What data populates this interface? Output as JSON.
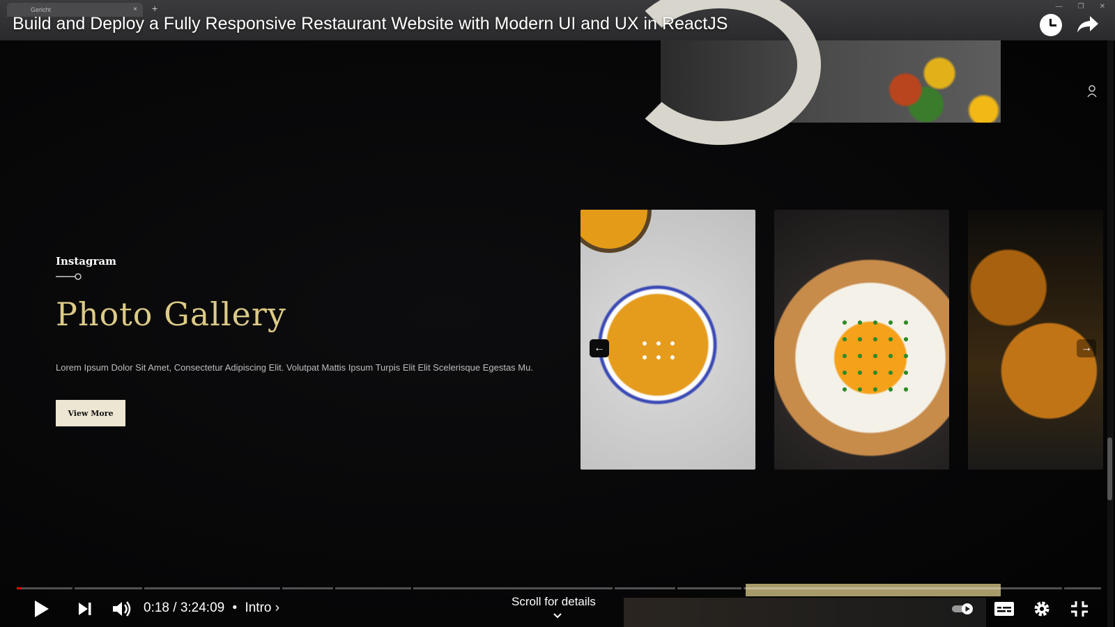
{
  "browser": {
    "tab_title": "Gericht",
    "tab_close": "×",
    "new_tab": "+",
    "window_controls": [
      "—",
      "❐",
      "✕"
    ]
  },
  "video": {
    "title": "Build and Deploy a Fully Responsive Restaurant Website with Modern UI and UX in ReactJS",
    "watch_later_icon": "clock-icon",
    "share_icon": "share-arrow-icon"
  },
  "page": {
    "gallery": {
      "subtitle": "Instagram",
      "title": "Photo Gallery",
      "description": "Lorem Ipsum Dolor Sit Amet, Consectetur Adipiscing Elit. Volutpat Mattis Ipsum Turpis Elit Elit Scelerisque Egestas Mu.",
      "button_label": "View More",
      "title_color": "#dcca87",
      "arrow_left": "←",
      "arrow_right": "→",
      "images": [
        "pumpkin-soup-image",
        "fried-egg-toast-image",
        "whiskey-glass-image"
      ]
    }
  },
  "player": {
    "time_current": "0:18",
    "time_total": "3:24:09",
    "separator": "/",
    "chapter_separator": "•",
    "chapter": "Intro",
    "chapter_chevron": "›",
    "scroll_hint": "Scroll for details",
    "progress": 0.0015,
    "progress_color": "#ff0000",
    "controls": [
      "play-icon",
      "next-icon",
      "volume-icon",
      "autoplay-toggle",
      "captions-icon",
      "settings-icon",
      "exit-fullscreen-icon"
    ]
  }
}
